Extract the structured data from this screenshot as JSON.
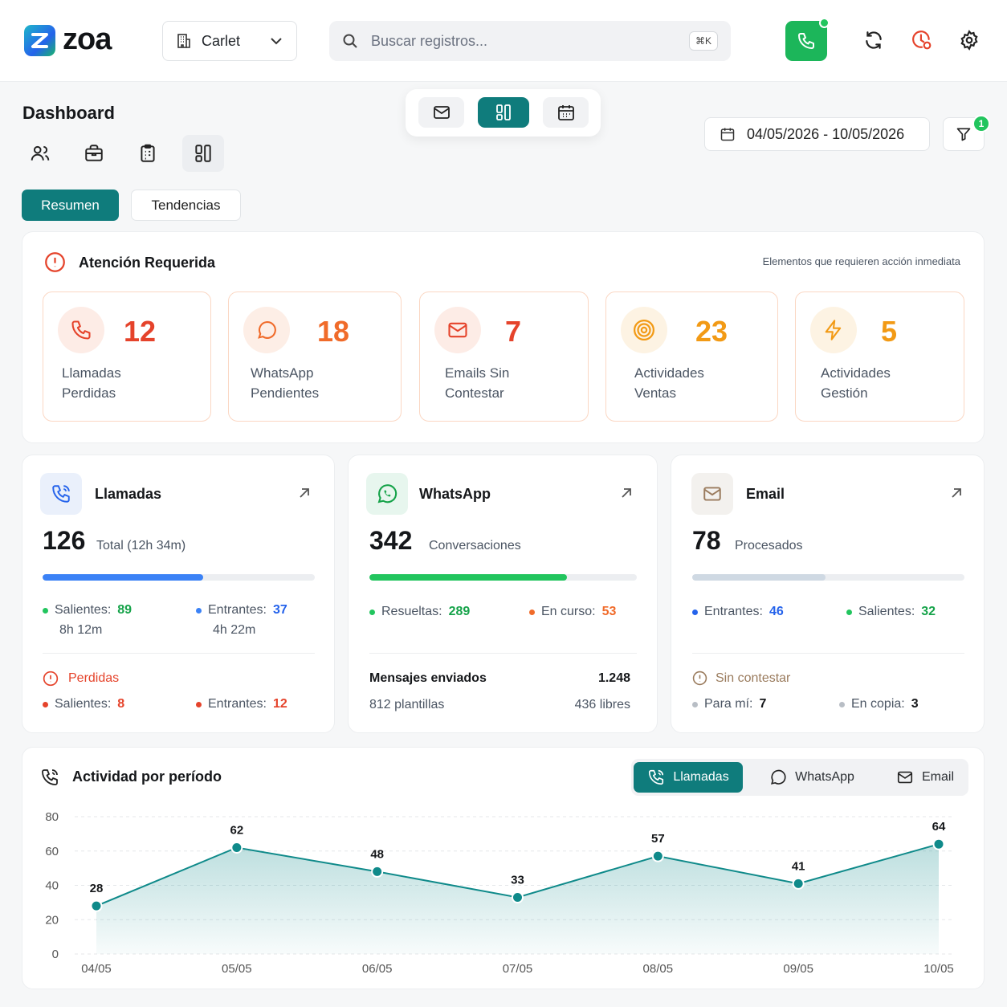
{
  "header": {
    "logo": "zoa",
    "company": "Carlet",
    "search_placeholder": "Buscar registros...",
    "search_shortcut": "⌘K"
  },
  "dashboard": {
    "title": "Dashboard",
    "date_range": "04/05/2026 - 10/05/2026",
    "filter_count": "1",
    "tabs": [
      "Resumen",
      "Tendencias"
    ]
  },
  "attention": {
    "title": "Atención Requerida",
    "subtitle": "Elementos que requieren acción inmediata",
    "items": [
      {
        "value": "12",
        "label1": "Llamadas",
        "label2": "Perdidas",
        "color": "#e5432b"
      },
      {
        "value": "18",
        "label1": "WhatsApp",
        "label2": "Pendientes",
        "color": "#f06b2a"
      },
      {
        "value": "7",
        "label1": "Emails Sin",
        "label2": "Contestar",
        "color": "#e5432b"
      },
      {
        "value": "23",
        "label1": "Actividades",
        "label2": "Ventas",
        "color": "#f29a15"
      },
      {
        "value": "5",
        "label1": "Actividades",
        "label2": "Gestión",
        "color": "#f29a15"
      }
    ]
  },
  "calls": {
    "title": "Llamadas",
    "total": "126",
    "total_sub": "Total (12h 34m)",
    "progress": 0.59,
    "out_label": "Salientes:",
    "out_value": "89",
    "out_time": "8h 12m",
    "in_label": "Entrantes:",
    "in_value": "37",
    "in_time": "4h 22m",
    "lost_label": "Perdidas",
    "lost_out_label": "Salientes:",
    "lost_out_value": "8",
    "lost_in_label": "Entrantes:",
    "lost_in_value": "12"
  },
  "whatsapp": {
    "title": "WhatsApp",
    "total": "342",
    "total_sub": "Conversaciones",
    "progress": 0.74,
    "resolved_label": "Resueltas:",
    "resolved_value": "289",
    "ongoing_label": "En curso:",
    "ongoing_value": "53",
    "sent_label": "Mensajes enviados",
    "sent_value": "1.248",
    "templates": "812 plantillas",
    "free": "436 libres"
  },
  "email": {
    "title": "Email",
    "total": "78",
    "total_sub": "Procesados",
    "progress": 0.49,
    "in_label": "Entrantes:",
    "in_value": "46",
    "out_label": "Salientes:",
    "out_value": "32",
    "unanswered_label": "Sin contestar",
    "to_me_label": "Para mí:",
    "to_me_value": "7",
    "cc_label": "En copia:",
    "cc_value": "3"
  },
  "activity": {
    "title": "Actividad por período",
    "tabs": [
      "Llamadas",
      "WhatsApp",
      "Email"
    ]
  },
  "chart_data": {
    "type": "area",
    "title": "Actividad por período",
    "xlabel": "",
    "ylabel": "",
    "categories": [
      "04/05",
      "05/05",
      "06/05",
      "07/05",
      "08/05",
      "09/05",
      "10/05"
    ],
    "values": [
      28,
      62,
      48,
      33,
      57,
      41,
      64
    ],
    "yticks": [
      0,
      20,
      40,
      60,
      80
    ],
    "ylim": [
      0,
      80
    ],
    "grid": true,
    "color": "#0f8a8a"
  }
}
